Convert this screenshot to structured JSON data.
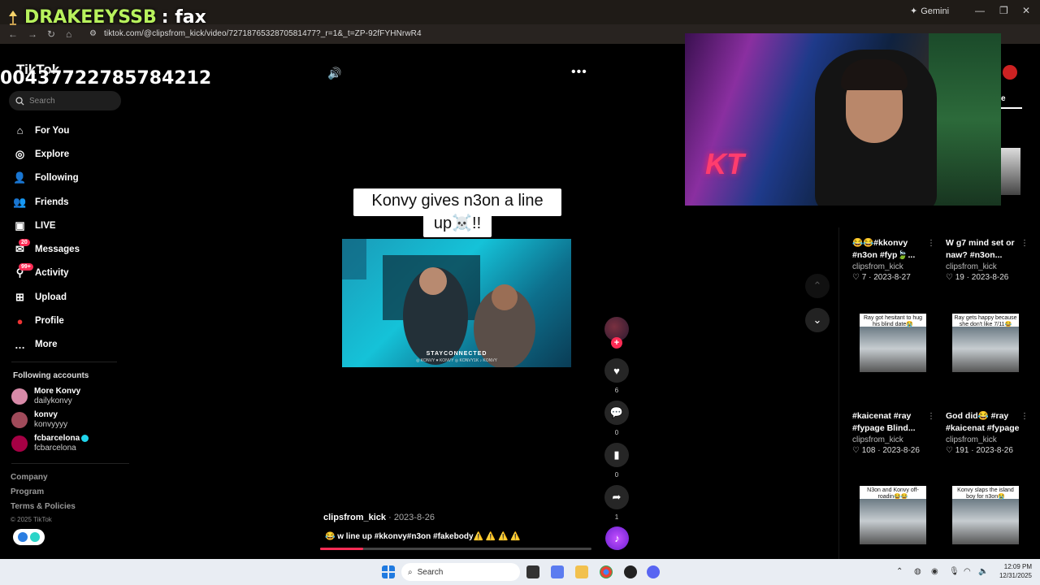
{
  "stream": {
    "handle": "DRAKEEYSSB",
    "suffix": " : fax",
    "overlay_number": "00437722785784212"
  },
  "browser": {
    "url": "tiktok.com/@clipsfrom_kick/video/7271876532870581477?_r=1&_t=ZP-92fFYHNrwR4",
    "gemini_label": "Gemini"
  },
  "tiktok": {
    "logo": "TikTok",
    "search_placeholder": "Search",
    "nav": [
      {
        "label": "For You",
        "icon": "home-icon"
      },
      {
        "label": "Explore",
        "icon": "compass-icon"
      },
      {
        "label": "Following",
        "icon": "following-icon"
      },
      {
        "label": "Friends",
        "icon": "friends-icon"
      },
      {
        "label": "LIVE",
        "icon": "live-icon"
      },
      {
        "label": "Messages",
        "icon": "messages-icon",
        "badge": "20"
      },
      {
        "label": "Activity",
        "icon": "activity-icon",
        "badge": "99+"
      },
      {
        "label": "Upload",
        "icon": "upload-icon"
      },
      {
        "label": "Profile",
        "icon": "profile-icon"
      },
      {
        "label": "More",
        "icon": "more-icon"
      }
    ],
    "following_title": "Following accounts",
    "accounts": [
      {
        "name": "More Konvy",
        "username": "dailykonvy",
        "color": "#d88aa8"
      },
      {
        "name": "konvy",
        "username": "konvyyyy",
        "color": "#a04a5a"
      },
      {
        "name": "fcbarcelona",
        "username": "fcbarcelona",
        "verified": true,
        "color": "#a50044"
      }
    ],
    "footer": [
      "Company",
      "Program",
      "Terms & Policies"
    ],
    "copyright": "© 2025 TikTok"
  },
  "video": {
    "caption_line1": "Konvy gives n3on a line",
    "caption_line2": "up☠️!!",
    "watermark": "STAYCONNECTED",
    "watermark_sub": "◎ KONVY ♥ KONVY ◎ KONVY1K ♪ KONVY",
    "author": "clipsfrom_kick",
    "date": " · 2023-8-26",
    "description": "😂 w line up #kkonvy#n3on #fakebody⚠️ ⚠️ ⚠️ ⚠️",
    "likes": "6",
    "comments": "0",
    "saves": "0",
    "shares": "1",
    "progress": 0.16
  },
  "right_panel": {
    "tab_label": "e"
  },
  "grid": [
    {
      "title": "😂😂#kkonvy #n3on #fyp🍃...",
      "user": "clipsfrom_kick",
      "likes": "7",
      "date": "2023-8-27"
    },
    {
      "title": "W g7 mind set or naw? #n3on...",
      "user": "clipsfrom_kick",
      "likes": "19",
      "date": "2023-8-26"
    },
    {
      "title": "#kaicenat #ray #fypage Blind...",
      "user": "clipsfrom_kick",
      "likes": "108",
      "date": "2023-8-26",
      "thumb": "Ray got hesitant to hug his blind date😭"
    },
    {
      "title": "God did😂 #ray #kaicenat #fypage",
      "user": "clipsfrom_kick",
      "likes": "191",
      "date": "2023-8-26",
      "thumb": "Ray gets happy because she don't like 7/11😂"
    },
    {
      "thumb": "N3on and Konvy off-roadin😂😂"
    },
    {
      "thumb": "Konvy slaps the island boy for n3on😭"
    }
  ],
  "taskbar": {
    "search": "Search",
    "time": "12:09 PM",
    "date": "12/31/2025"
  },
  "colors": {
    "accent": "#fe2c55",
    "handle": "#b8f25d"
  }
}
